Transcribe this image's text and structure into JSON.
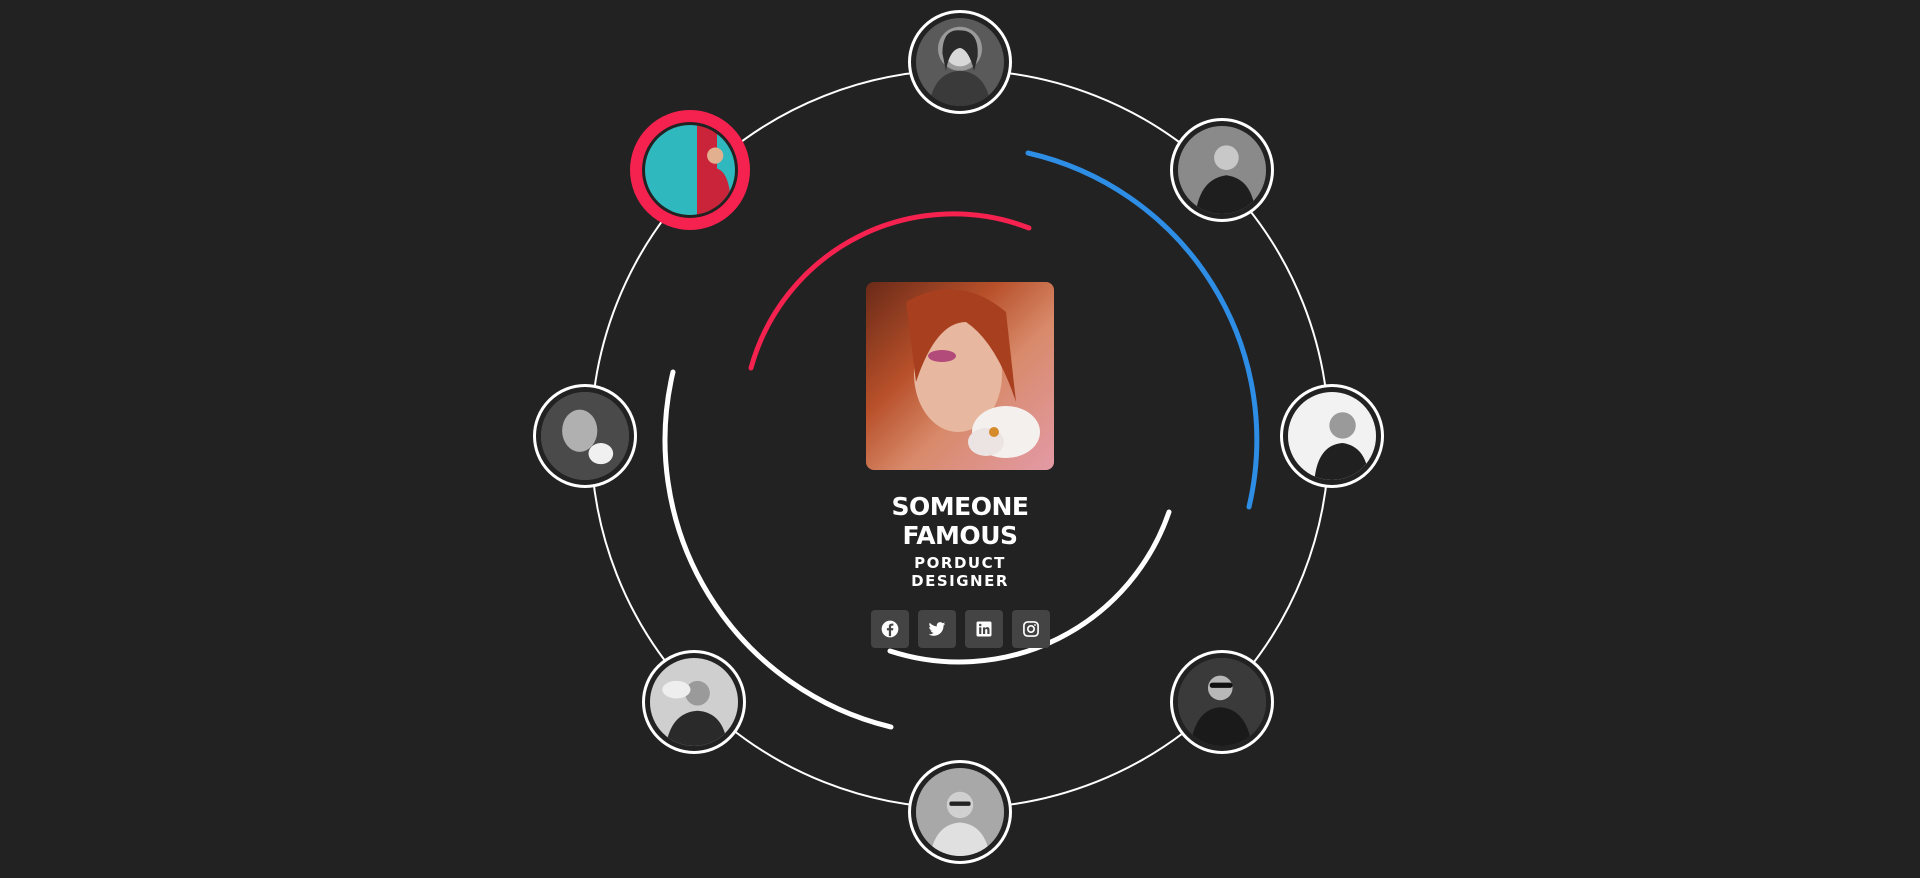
{
  "profile": {
    "name": "SOMEONE FAMOUS",
    "role": "PORDUCT DESIGNER"
  },
  "socials": [
    {
      "icon": "facebook-icon"
    },
    {
      "icon": "twitter-icon"
    },
    {
      "icon": "linkedin-icon"
    },
    {
      "icon": "instagram-icon"
    }
  ],
  "avatars": [
    {
      "name": "avatar-top",
      "active": false
    },
    {
      "name": "avatar-top-right",
      "active": false
    },
    {
      "name": "avatar-right",
      "active": false
    },
    {
      "name": "avatar-bottom-right",
      "active": false
    },
    {
      "name": "avatar-bottom",
      "active": false
    },
    {
      "name": "avatar-bottom-left",
      "active": false
    },
    {
      "name": "avatar-left",
      "active": false
    },
    {
      "name": "avatar-top-left",
      "active": true
    }
  ],
  "colors": {
    "background": "#222222",
    "accent_red": "#f5214e",
    "accent_blue": "#2e8ee6",
    "ring": "#ffffff",
    "social_bg": "#444444"
  }
}
